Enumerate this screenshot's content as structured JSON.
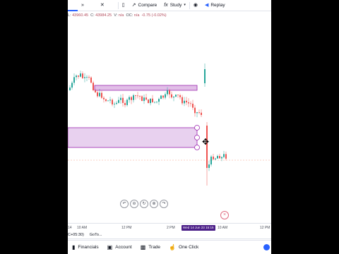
{
  "toolbar": {
    "fastforward_icon": "fast-forward-icon",
    "close_icon": "close-icon",
    "candle_icon": "candles-icon",
    "compare_label": "Compare",
    "study_label": "Study",
    "camera_icon": "camera-icon",
    "replay_label": "Replay"
  },
  "ohlc": {
    "low_key": "L:",
    "low": "43960.45",
    "close_key": "C:",
    "close": "43984.25",
    "volume_key": "V:",
    "volume": "n/a",
    "oc_key": "OC:",
    "oc": "n/a",
    "change": "-0.75",
    "change_pct": "(-0.02%)"
  },
  "colors": {
    "up": "#26a69a",
    "down": "#ef5350",
    "zone_fill": "#e1bee7",
    "zone_stroke": "#9c27b0",
    "accent": "#2962ff"
  },
  "time_axis": {
    "ticks": [
      "14",
      "10 AM",
      "12 PM",
      "2 PM",
      "10 AM",
      "12 PM"
    ],
    "crosshair_time": "Wed 14 Jun 23 15:15"
  },
  "bottom": {
    "timezone": "C+05:30)",
    "goto": "GoTo..."
  },
  "nav": {
    "financials": "Financials",
    "account": "Account",
    "trade": "Trade",
    "one_click": "One Click"
  },
  "zoom_tools": [
    "undo-icon",
    "zoom-out-icon",
    "reset-icon",
    "zoom-in-icon",
    "redo-icon"
  ]
}
